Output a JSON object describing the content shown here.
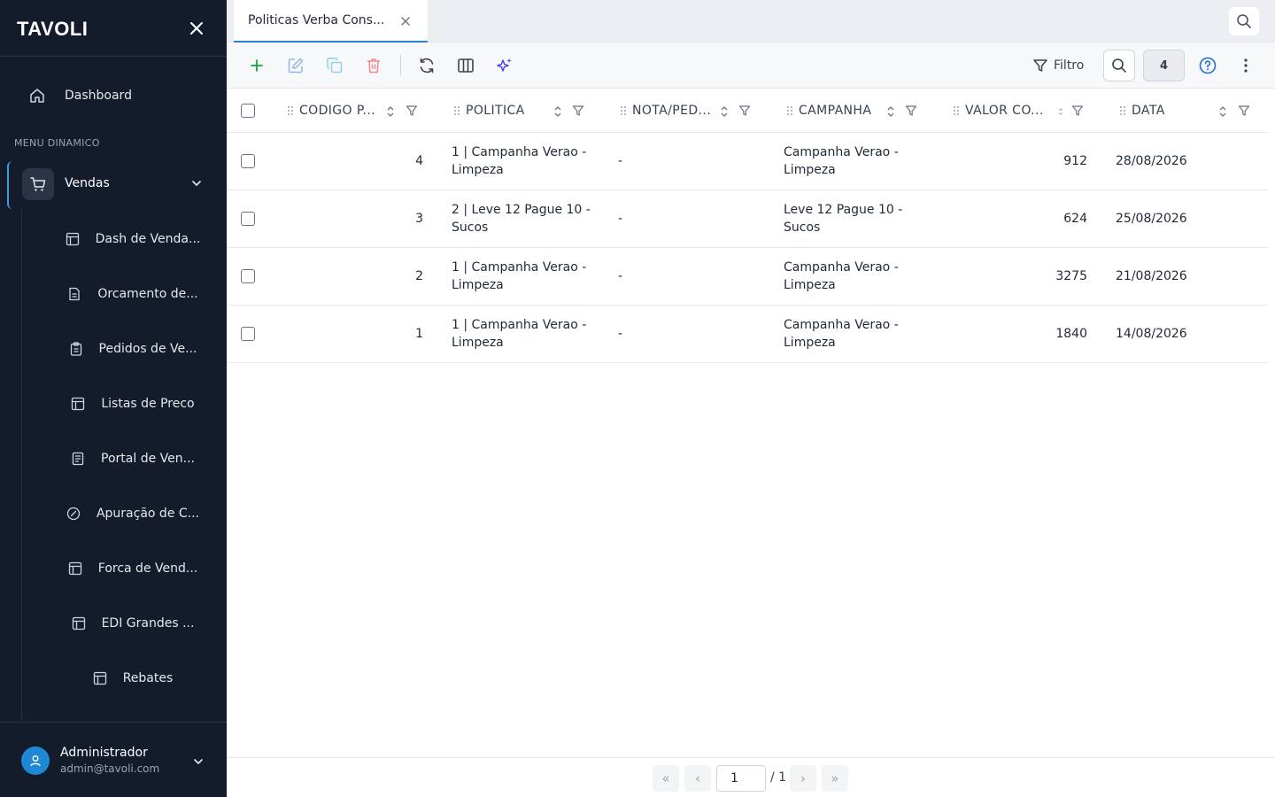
{
  "sidebar": {
    "brand": "TAVOLI",
    "dashboard_label": "Dashboard",
    "section_label": "MENU DINAMICO",
    "vendas_label": "Vendas",
    "items": [
      {
        "label": "Dash de Venda...",
        "icon": "layout-icon"
      },
      {
        "label": "Orcamento de...",
        "icon": "document-icon"
      },
      {
        "label": "Pedidos de Ve...",
        "icon": "clipboard-icon"
      },
      {
        "label": "Listas de Preco",
        "icon": "layout-icon"
      },
      {
        "label": "Portal de Ven...",
        "icon": "document-icon"
      },
      {
        "label": "Apuração de C...",
        "icon": "percent-icon"
      },
      {
        "label": "Forca de Vend...",
        "icon": "layout-icon"
      },
      {
        "label": "EDI Grandes ...",
        "icon": "layout-icon"
      },
      {
        "label": "Rebates",
        "icon": "layout-icon"
      }
    ],
    "user": {
      "name": "Administrador",
      "email": "admin@tavoli.com"
    }
  },
  "tabs": [
    {
      "label": "Politicas Verba Cons...",
      "active": true
    }
  ],
  "toolbar": {
    "filter_label": "Filtro",
    "record_count": "4"
  },
  "table": {
    "columns": [
      "CODIGO P...",
      "POLITICA",
      "NOTA/PED...",
      "CAMPANHA",
      "VALOR CO...",
      "DATA"
    ],
    "rows": [
      {
        "codigo": "4",
        "politica": "1 | Campanha Verao - Limpeza",
        "nota": "-",
        "campanha": "Campanha Verao - Limpeza",
        "valor": "912",
        "data": "28/08/2026"
      },
      {
        "codigo": "3",
        "politica": "2 | Leve 12 Pague 10 - Sucos",
        "nota": "-",
        "campanha": "Leve 12 Pague 10 - Sucos",
        "valor": "624",
        "data": "25/08/2026"
      },
      {
        "codigo": "2",
        "politica": "1 | Campanha Verao - Limpeza",
        "nota": "-",
        "campanha": "Campanha Verao - Limpeza",
        "valor": "3275",
        "data": "21/08/2026"
      },
      {
        "codigo": "1",
        "politica": "1 | Campanha Verao - Limpeza",
        "nota": "-",
        "campanha": "Campanha Verao - Limpeza",
        "valor": "1840",
        "data": "14/08/2026"
      }
    ]
  },
  "pagination": {
    "current": "1",
    "total": "/ 1",
    "first": "«",
    "prev": "‹",
    "next": "›",
    "last": "»"
  },
  "colors": {
    "sidebar_bg": "#141c2c",
    "accent": "#2f7fd0",
    "add": "#16a34a",
    "delete": "#ef4444",
    "ai": "#4f46e5"
  }
}
